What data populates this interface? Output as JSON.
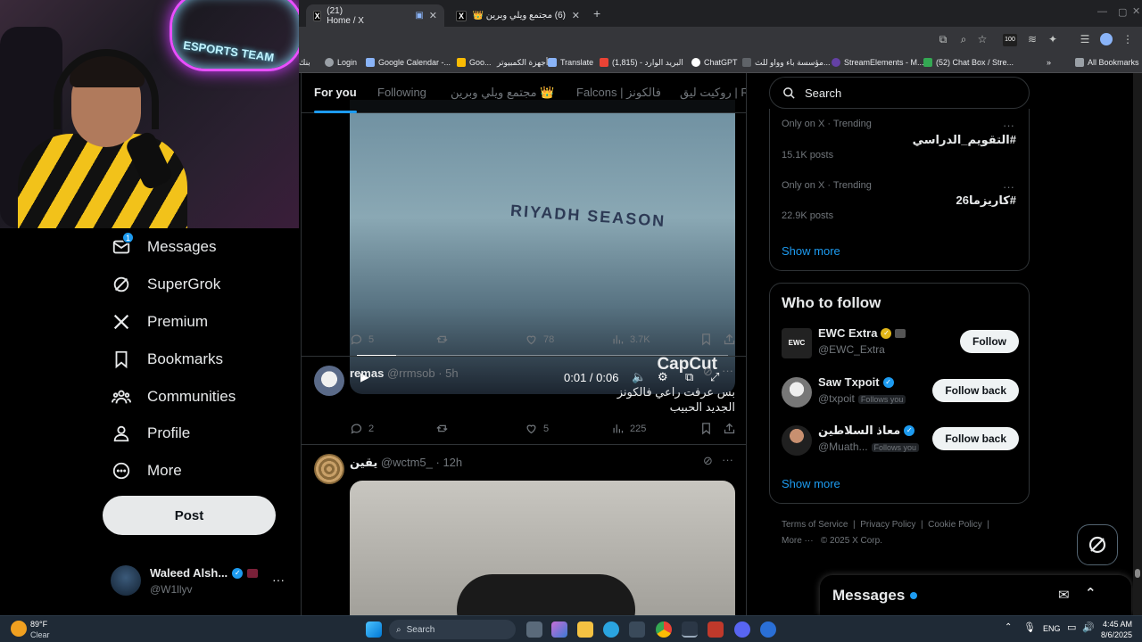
{
  "browser": {
    "tabs": [
      {
        "title": "(21) Home / X",
        "active": true
      },
      {
        "title": "(6) مجتمع ويلي وبرين 👑 / X",
        "active": false
      }
    ],
    "new_tab": "+",
    "bookmarks": [
      "بنك",
      "Login",
      "Google Calendar -...",
      "Goo...",
      "أجهزة الكمبيوتر",
      "Translate",
      "البريد الوارد - (1,815)",
      "ChatGPT",
      "مؤسسة باء وواو للث...",
      "StreamElements - M...",
      "(52) Chat Box / Stre..."
    ],
    "all_bookmarks": "All Bookmarks",
    "extension_badge": "100"
  },
  "nav": {
    "messages_badge": "1",
    "items": [
      "Messages",
      "SuperGrok",
      "Premium",
      "Bookmarks",
      "Communities",
      "Profile",
      "More"
    ],
    "post_label": "Post",
    "account": {
      "name": "Waleed Alsh...",
      "handle": "@W1llyv"
    }
  },
  "timeline": {
    "tabs": [
      "For you",
      "Following",
      "مجتمع ويلي وبرين 👑",
      "Falcons | فالكونز",
      "روكيت ليق | RL"
    ],
    "video": {
      "time": "0:01 / 0:06",
      "watermark": "CapCut",
      "shirt_text": "RIYADH SEASON"
    },
    "video_actions": {
      "replies": "5",
      "reposts": "",
      "likes": "78",
      "views": "3.7K"
    },
    "tweets": [
      {
        "name": "remas",
        "handle": "@rrmsob",
        "time": "5h",
        "text": "بس عرفت راعي فالكونز الجديد الحبيب",
        "replies": "2",
        "likes": "5",
        "views": "225"
      },
      {
        "name": "يقين",
        "handle": "@wctm5_",
        "time": "12h",
        "text": ""
      }
    ]
  },
  "sidebar": {
    "search_placeholder": "Search",
    "trends": [
      {
        "context": "Only on X · Trending",
        "name": "#التقويم_الدراسي",
        "count": "15.1K posts"
      },
      {
        "context": "Only on X · Trending",
        "name": "#كاريزما26",
        "count": "22.9K posts"
      }
    ],
    "show_more": "Show more",
    "who_to_follow": {
      "title": "Who to follow",
      "accounts": [
        {
          "name": "EWC Extra",
          "handle": "@EWC_Extra",
          "button": "Follow",
          "follows_you": "",
          "verified": "gold"
        },
        {
          "name": "Saw Txpoit",
          "handle": "@txpoit",
          "button": "Follow back",
          "follows_you": "Follows you",
          "verified": "blue"
        },
        {
          "name": "معاذ السلاطين",
          "handle": "@Muath...",
          "button": "Follow back",
          "follows_you": "Follows you",
          "verified": "blue"
        }
      ],
      "show_more": "Show more"
    },
    "footer": {
      "terms": "Terms of Service",
      "privacy": "Privacy Policy",
      "cookie": "Cookie Policy",
      "more": "More ···",
      "copyright": "© 2025 X Corp."
    },
    "messages_drawer": "Messages"
  },
  "webcam": {
    "neon_text": "ESPORTS TEAM"
  },
  "taskbar": {
    "weather_temp": "89°F",
    "weather_desc": "Clear",
    "search": "Search",
    "lang": "ENG",
    "time": "4:45 AM",
    "date": "8/6/2025"
  },
  "colors": {
    "accent": "#1d9bf0",
    "background": "#000000",
    "border": "#2f3336",
    "muted": "#71767b"
  }
}
